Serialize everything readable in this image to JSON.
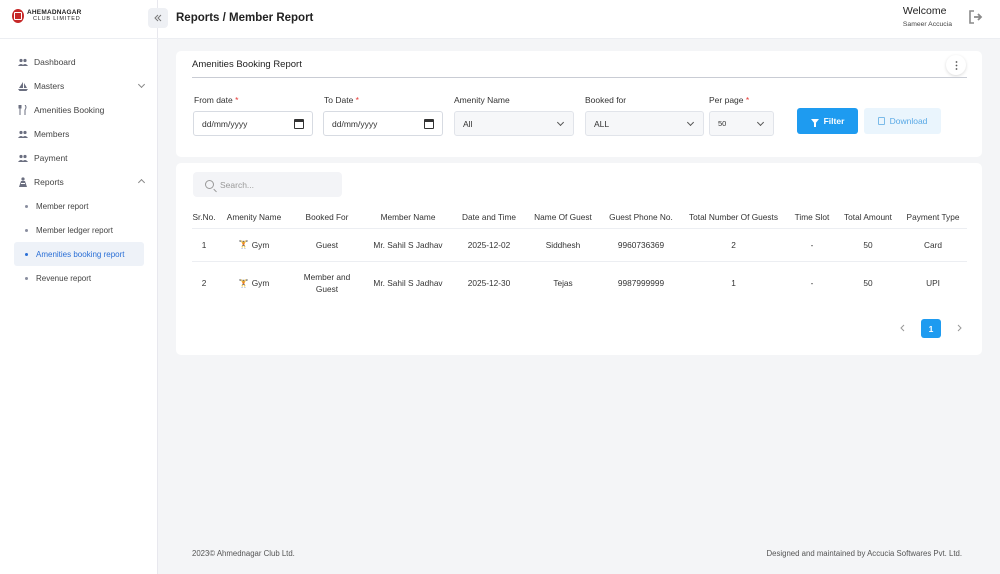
{
  "brand": {
    "line1": "AHEMADNAGAR",
    "line2": "CLUB LIMITED"
  },
  "sidebar": {
    "items": [
      {
        "label": "Dashboard"
      },
      {
        "label": "Masters"
      },
      {
        "label": "Amenities Booking"
      },
      {
        "label": "Members"
      },
      {
        "label": "Payment"
      },
      {
        "label": "Reports"
      }
    ],
    "sub_items": [
      {
        "label": "Member report"
      },
      {
        "label": "Member ledger report"
      },
      {
        "label": "Amenities booking report"
      },
      {
        "label": "Revenue report"
      }
    ]
  },
  "header": {
    "breadcrumb": "Reports / Member Report",
    "welcome": "Welcome",
    "user": "Sameer Accucia"
  },
  "filter_card": {
    "title": "Amenities Booking Report",
    "from_date_label": "From date",
    "from_date_value": "dd/mm/yyyy",
    "to_date_label": "To Date",
    "to_date_value": "dd/mm/yyyy",
    "amenity_label": "Amenity Name",
    "amenity_value": "All",
    "booked_for_label": "Booked for",
    "booked_for_value": "ALL",
    "per_page_label": "Per page",
    "per_page_value": "50",
    "required_mark": "*",
    "filter_button": "Filter",
    "download_button": "Download"
  },
  "table": {
    "search_placeholder": "Search...",
    "columns": [
      "Sr.No.",
      "Amenity Name",
      "Booked For",
      "Member Name",
      "Date and Time",
      "Name Of Guest",
      "Guest Phone No.",
      "Total Number Of Guests",
      "Time Slot",
      "Total Amount",
      "Payment Type"
    ],
    "rows": [
      [
        "1",
        "Gym",
        "Guest",
        "Mr. Sahil S Jadhav",
        "2025-12-02",
        "Siddhesh",
        "9960736369",
        "2",
        "-",
        "50",
        "Card"
      ],
      [
        "2",
        "Gym",
        "Member and Guest",
        "Mr. Sahil S Jadhav",
        "2025-12-30",
        "Tejas",
        "9987999999",
        "1",
        "-",
        "50",
        "UPI"
      ]
    ],
    "current_page": "1"
  },
  "footer": {
    "left": "2023©  Ahmednagar Club Ltd.",
    "right": "Designed and maintained by Accucia Softwares Pvt. Ltd."
  },
  "colors": {
    "accent": "#1e9bf0",
    "active_link": "#2a6fd6"
  }
}
